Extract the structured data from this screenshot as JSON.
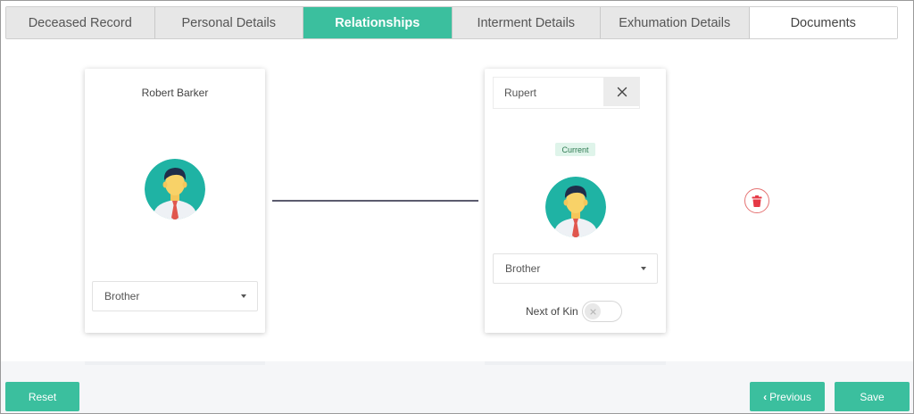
{
  "tabs": [
    {
      "label": "Deceased Record",
      "active": false
    },
    {
      "label": "Personal Details",
      "active": false
    },
    {
      "label": "Relationships",
      "active": true
    },
    {
      "label": "Interment Details",
      "active": false
    },
    {
      "label": "Exhumation Details",
      "active": false
    },
    {
      "label": "Documents",
      "active": false
    }
  ],
  "deceased_card": {
    "name": "Robert Barker",
    "avatar_icon": "person-avatar-icon",
    "relationship_select": "Brother"
  },
  "relative_card": {
    "name_input_value": "Rupert",
    "clear_icon": "close-icon",
    "status_badge": "Current",
    "avatar_icon": "person-avatar-icon",
    "relationship_select": "Brother",
    "next_of_kin_label": "Next of Kin",
    "next_of_kin_on": false
  },
  "delete_icon": "trash-icon",
  "footer": {
    "reset_label": "Reset",
    "previous_label": "Previous",
    "save_label": "Save"
  },
  "colors": {
    "accent": "#3bbf9e",
    "delete": "#e53946",
    "tab_inactive": "#e7e7e7"
  }
}
